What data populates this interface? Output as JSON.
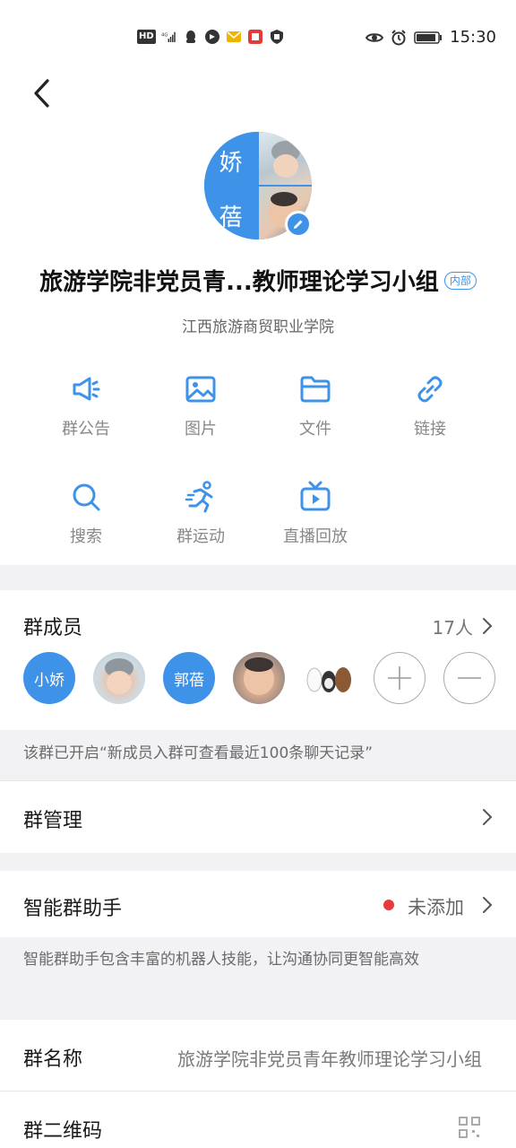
{
  "status_bar": {
    "time": "15:30",
    "hd_label": "HD",
    "network_label": "4G"
  },
  "header": {
    "back_icon": "chevron-left-icon"
  },
  "group": {
    "avatar_chars": [
      "娇",
      "蓓"
    ],
    "title": "旅游学院非党员青...教师理论学习小组",
    "badge": "内部",
    "organization": "江西旅游商贸职业学院"
  },
  "features": [
    {
      "label": "群公告",
      "icon": "megaphone-icon"
    },
    {
      "label": "图片",
      "icon": "image-icon"
    },
    {
      "label": "文件",
      "icon": "folder-icon"
    },
    {
      "label": "链接",
      "icon": "link-icon"
    },
    {
      "label": "搜索",
      "icon": "search-icon"
    },
    {
      "label": "群运动",
      "icon": "running-icon"
    },
    {
      "label": "直播回放",
      "icon": "tv-play-icon"
    }
  ],
  "members": {
    "label": "群成员",
    "count": "17人",
    "avatars": [
      {
        "text": "小娇",
        "type": "text"
      },
      {
        "text": "",
        "type": "photo"
      },
      {
        "text": "郭蓓",
        "type": "text"
      },
      {
        "text": "",
        "type": "photo"
      },
      {
        "text": "",
        "type": "sticker"
      }
    ],
    "notice": "该群已开启“新成员入群可查看最近100条聊天记录”"
  },
  "management": {
    "label": "群管理"
  },
  "assistant": {
    "label": "智能群助手",
    "status": "未添加",
    "description": "智能群助手包含丰富的机器人技能，让沟通协同更智能高效"
  },
  "group_name": {
    "label": "群名称",
    "value": "旅游学院非党员青年教师理论学习小组"
  },
  "qr_code": {
    "label": "群二维码"
  },
  "colors": {
    "accent": "#3e93e8",
    "red_dot": "#e83a3a",
    "band_gray": "#f2f2f4"
  }
}
